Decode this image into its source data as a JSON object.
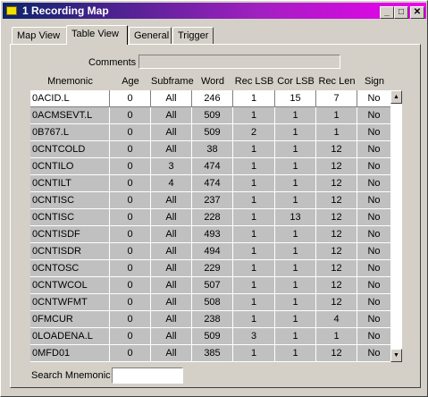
{
  "window": {
    "title": "1 Recording Map",
    "minimize": "_",
    "maximize": "□",
    "close": "✕"
  },
  "tabs": [
    {
      "label": "Map View"
    },
    {
      "label": "Table View",
      "active": true
    },
    {
      "label": "General"
    },
    {
      "label": "Trigger"
    }
  ],
  "comments": {
    "label": "Comments",
    "value": ""
  },
  "table": {
    "columns": [
      "Mnemonic",
      "Age",
      "Subframe",
      "Word",
      "Rec LSB",
      "Cor LSB",
      "Rec Len",
      "Sign"
    ],
    "rows": [
      [
        "0ACID.L",
        "0",
        "All",
        "246",
        "1",
        "15",
        "7",
        "No"
      ],
      [
        "0ACMSEVT.L",
        "0",
        "All",
        "509",
        "1",
        "1",
        "1",
        "No"
      ],
      [
        "0B767.L",
        "0",
        "All",
        "509",
        "2",
        "1",
        "1",
        "No"
      ],
      [
        "0CNTCOLD",
        "0",
        "All",
        "38",
        "1",
        "1",
        "12",
        "No"
      ],
      [
        "0CNTILO",
        "0",
        "3",
        "474",
        "1",
        "1",
        "12",
        "No"
      ],
      [
        "0CNTILT",
        "0",
        "4",
        "474",
        "1",
        "1",
        "12",
        "No"
      ],
      [
        "0CNTISC",
        "0",
        "All",
        "237",
        "1",
        "1",
        "12",
        "No"
      ],
      [
        "0CNTISC",
        "0",
        "All",
        "228",
        "1",
        "13",
        "12",
        "No"
      ],
      [
        "0CNTISDF",
        "0",
        "All",
        "493",
        "1",
        "1",
        "12",
        "No"
      ],
      [
        "0CNTISDR",
        "0",
        "All",
        "494",
        "1",
        "1",
        "12",
        "No"
      ],
      [
        "0CNTOSC",
        "0",
        "All",
        "229",
        "1",
        "1",
        "12",
        "No"
      ],
      [
        "0CNTWCOL",
        "0",
        "All",
        "507",
        "1",
        "1",
        "12",
        "No"
      ],
      [
        "0CNTWFMT",
        "0",
        "All",
        "508",
        "1",
        "1",
        "12",
        "No"
      ],
      [
        "0FMCUR",
        "0",
        "All",
        "238",
        "1",
        "1",
        "4",
        "No"
      ],
      [
        "0LOADENA.L",
        "0",
        "All",
        "509",
        "3",
        "1",
        "1",
        "No"
      ],
      [
        "0MFD01",
        "0",
        "All",
        "385",
        "1",
        "1",
        "12",
        "No"
      ]
    ]
  },
  "search": {
    "label": "Search Mnemonic",
    "value": ""
  },
  "scroll": {
    "up": "▲",
    "down": "▼"
  }
}
